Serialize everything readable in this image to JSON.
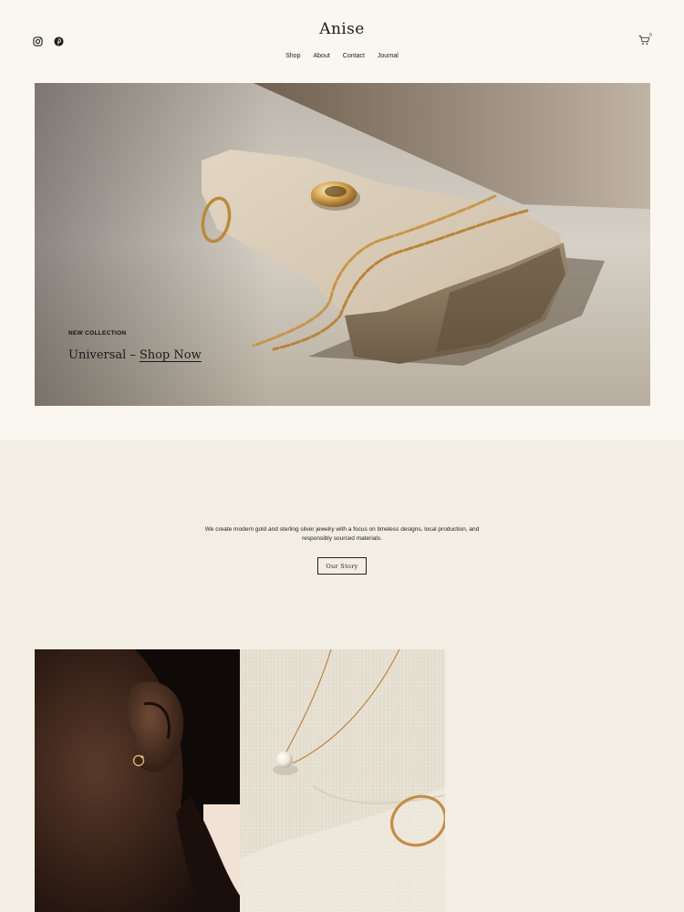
{
  "brand": {
    "name": "Anise"
  },
  "social": [
    {
      "icon": "instagram-icon"
    },
    {
      "icon": "pinterest-icon"
    }
  ],
  "nav": {
    "items": [
      "Shop",
      "About",
      "Contact",
      "Journal"
    ]
  },
  "cart": {
    "icon": "cart-icon",
    "count": "0"
  },
  "hero": {
    "eyebrow": "NEW COLLECTION",
    "title_prefix": "Universal",
    "separator": "–",
    "link_label": "Shop Now"
  },
  "about": {
    "text": "We create modern gold and sterling silver jewelry with a focus on timeless designs, local production, and responsibly sourced materials.",
    "button_label": "Our Story"
  },
  "colors": {
    "page_bg": "#faf7f1",
    "section_bg": "#f2eee3",
    "text": "#1c1c1c",
    "gold": "#c8954a"
  }
}
